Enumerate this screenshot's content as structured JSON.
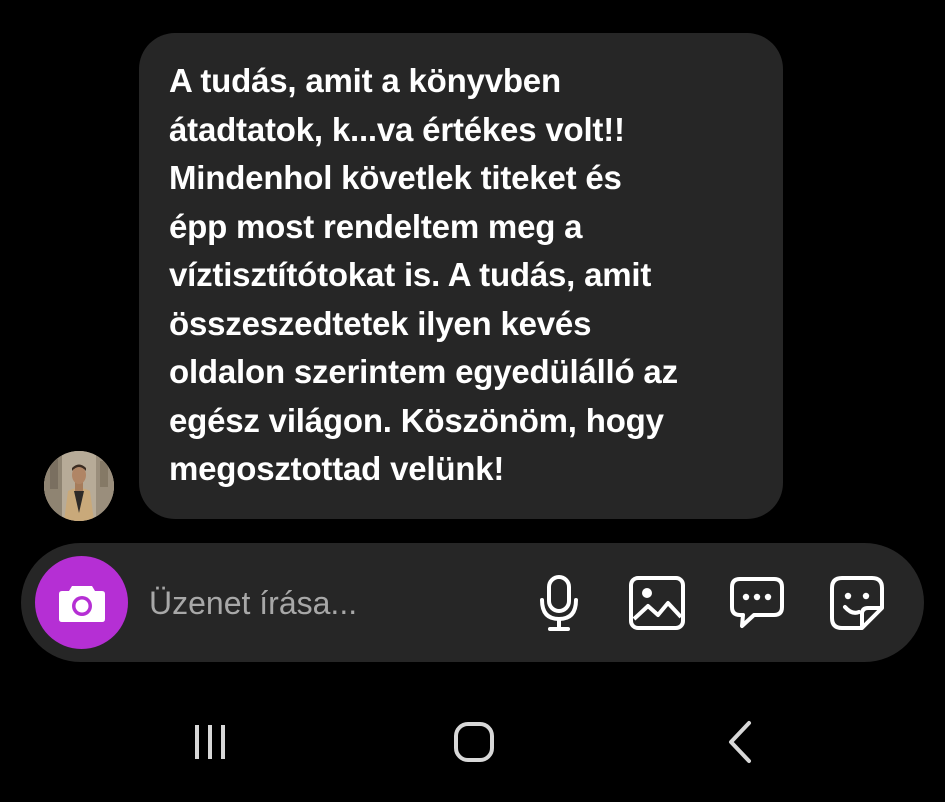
{
  "conversation": {
    "message": {
      "text": "A tudás, amit a könyvben\nátadtatok, k...va értékes volt!!\nMindenhol követlek titeket és\népp most rendeltem meg a\nvíztisztítótokat is. A tudás, amit\nösszeszedtetek ilyen kevés\noldalon szerintem egyedülálló az\negész világon. Köszönöm, hogy\nmegosztottad velünk!"
    }
  },
  "composer": {
    "placeholder": "Üzenet írása...",
    "value": "",
    "camera_color": "#b52fd4",
    "icons": [
      "camera-icon",
      "microphone-icon",
      "gallery-icon",
      "chat-bubble-icon",
      "sticker-icon"
    ]
  },
  "navigation": {
    "icons": [
      "recent-apps-icon",
      "home-icon",
      "back-icon"
    ]
  },
  "theme": {
    "background": "#000000",
    "surface": "#262626",
    "text": "#ffffff",
    "placeholder": "#a8a8a8"
  }
}
